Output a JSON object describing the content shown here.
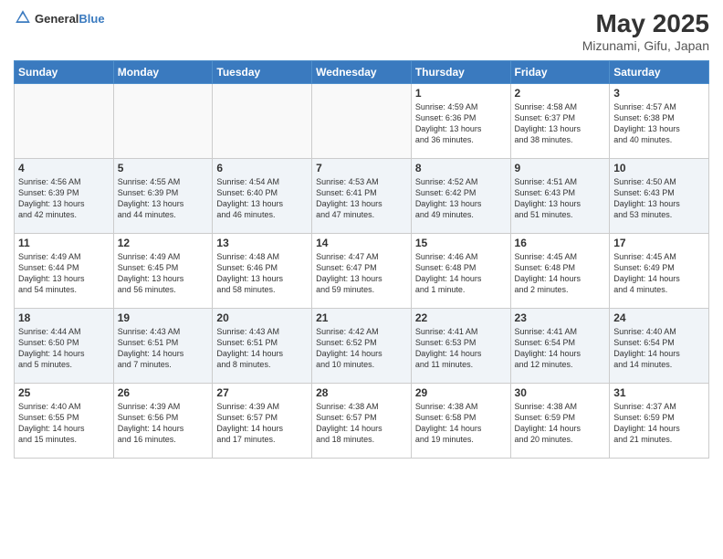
{
  "header": {
    "logo_general": "General",
    "logo_blue": "Blue",
    "main_title": "May 2025",
    "subtitle": "Mizunami, Gifu, Japan"
  },
  "calendar": {
    "headers": [
      "Sunday",
      "Monday",
      "Tuesday",
      "Wednesday",
      "Thursday",
      "Friday",
      "Saturday"
    ],
    "weeks": [
      [
        {
          "day": "",
          "info": ""
        },
        {
          "day": "",
          "info": ""
        },
        {
          "day": "",
          "info": ""
        },
        {
          "day": "",
          "info": ""
        },
        {
          "day": "1",
          "info": "Sunrise: 4:59 AM\nSunset: 6:36 PM\nDaylight: 13 hours\nand 36 minutes."
        },
        {
          "day": "2",
          "info": "Sunrise: 4:58 AM\nSunset: 6:37 PM\nDaylight: 13 hours\nand 38 minutes."
        },
        {
          "day": "3",
          "info": "Sunrise: 4:57 AM\nSunset: 6:38 PM\nDaylight: 13 hours\nand 40 minutes."
        }
      ],
      [
        {
          "day": "4",
          "info": "Sunrise: 4:56 AM\nSunset: 6:39 PM\nDaylight: 13 hours\nand 42 minutes."
        },
        {
          "day": "5",
          "info": "Sunrise: 4:55 AM\nSunset: 6:39 PM\nDaylight: 13 hours\nand 44 minutes."
        },
        {
          "day": "6",
          "info": "Sunrise: 4:54 AM\nSunset: 6:40 PM\nDaylight: 13 hours\nand 46 minutes."
        },
        {
          "day": "7",
          "info": "Sunrise: 4:53 AM\nSunset: 6:41 PM\nDaylight: 13 hours\nand 47 minutes."
        },
        {
          "day": "8",
          "info": "Sunrise: 4:52 AM\nSunset: 6:42 PM\nDaylight: 13 hours\nand 49 minutes."
        },
        {
          "day": "9",
          "info": "Sunrise: 4:51 AM\nSunset: 6:43 PM\nDaylight: 13 hours\nand 51 minutes."
        },
        {
          "day": "10",
          "info": "Sunrise: 4:50 AM\nSunset: 6:43 PM\nDaylight: 13 hours\nand 53 minutes."
        }
      ],
      [
        {
          "day": "11",
          "info": "Sunrise: 4:49 AM\nSunset: 6:44 PM\nDaylight: 13 hours\nand 54 minutes."
        },
        {
          "day": "12",
          "info": "Sunrise: 4:49 AM\nSunset: 6:45 PM\nDaylight: 13 hours\nand 56 minutes."
        },
        {
          "day": "13",
          "info": "Sunrise: 4:48 AM\nSunset: 6:46 PM\nDaylight: 13 hours\nand 58 minutes."
        },
        {
          "day": "14",
          "info": "Sunrise: 4:47 AM\nSunset: 6:47 PM\nDaylight: 13 hours\nand 59 minutes."
        },
        {
          "day": "15",
          "info": "Sunrise: 4:46 AM\nSunset: 6:48 PM\nDaylight: 14 hours\nand 1 minute."
        },
        {
          "day": "16",
          "info": "Sunrise: 4:45 AM\nSunset: 6:48 PM\nDaylight: 14 hours\nand 2 minutes."
        },
        {
          "day": "17",
          "info": "Sunrise: 4:45 AM\nSunset: 6:49 PM\nDaylight: 14 hours\nand 4 minutes."
        }
      ],
      [
        {
          "day": "18",
          "info": "Sunrise: 4:44 AM\nSunset: 6:50 PM\nDaylight: 14 hours\nand 5 minutes."
        },
        {
          "day": "19",
          "info": "Sunrise: 4:43 AM\nSunset: 6:51 PM\nDaylight: 14 hours\nand 7 minutes."
        },
        {
          "day": "20",
          "info": "Sunrise: 4:43 AM\nSunset: 6:51 PM\nDaylight: 14 hours\nand 8 minutes."
        },
        {
          "day": "21",
          "info": "Sunrise: 4:42 AM\nSunset: 6:52 PM\nDaylight: 14 hours\nand 10 minutes."
        },
        {
          "day": "22",
          "info": "Sunrise: 4:41 AM\nSunset: 6:53 PM\nDaylight: 14 hours\nand 11 minutes."
        },
        {
          "day": "23",
          "info": "Sunrise: 4:41 AM\nSunset: 6:54 PM\nDaylight: 14 hours\nand 12 minutes."
        },
        {
          "day": "24",
          "info": "Sunrise: 4:40 AM\nSunset: 6:54 PM\nDaylight: 14 hours\nand 14 minutes."
        }
      ],
      [
        {
          "day": "25",
          "info": "Sunrise: 4:40 AM\nSunset: 6:55 PM\nDaylight: 14 hours\nand 15 minutes."
        },
        {
          "day": "26",
          "info": "Sunrise: 4:39 AM\nSunset: 6:56 PM\nDaylight: 14 hours\nand 16 minutes."
        },
        {
          "day": "27",
          "info": "Sunrise: 4:39 AM\nSunset: 6:57 PM\nDaylight: 14 hours\nand 17 minutes."
        },
        {
          "day": "28",
          "info": "Sunrise: 4:38 AM\nSunset: 6:57 PM\nDaylight: 14 hours\nand 18 minutes."
        },
        {
          "day": "29",
          "info": "Sunrise: 4:38 AM\nSunset: 6:58 PM\nDaylight: 14 hours\nand 19 minutes."
        },
        {
          "day": "30",
          "info": "Sunrise: 4:38 AM\nSunset: 6:59 PM\nDaylight: 14 hours\nand 20 minutes."
        },
        {
          "day": "31",
          "info": "Sunrise: 4:37 AM\nSunset: 6:59 PM\nDaylight: 14 hours\nand 21 minutes."
        }
      ]
    ]
  }
}
